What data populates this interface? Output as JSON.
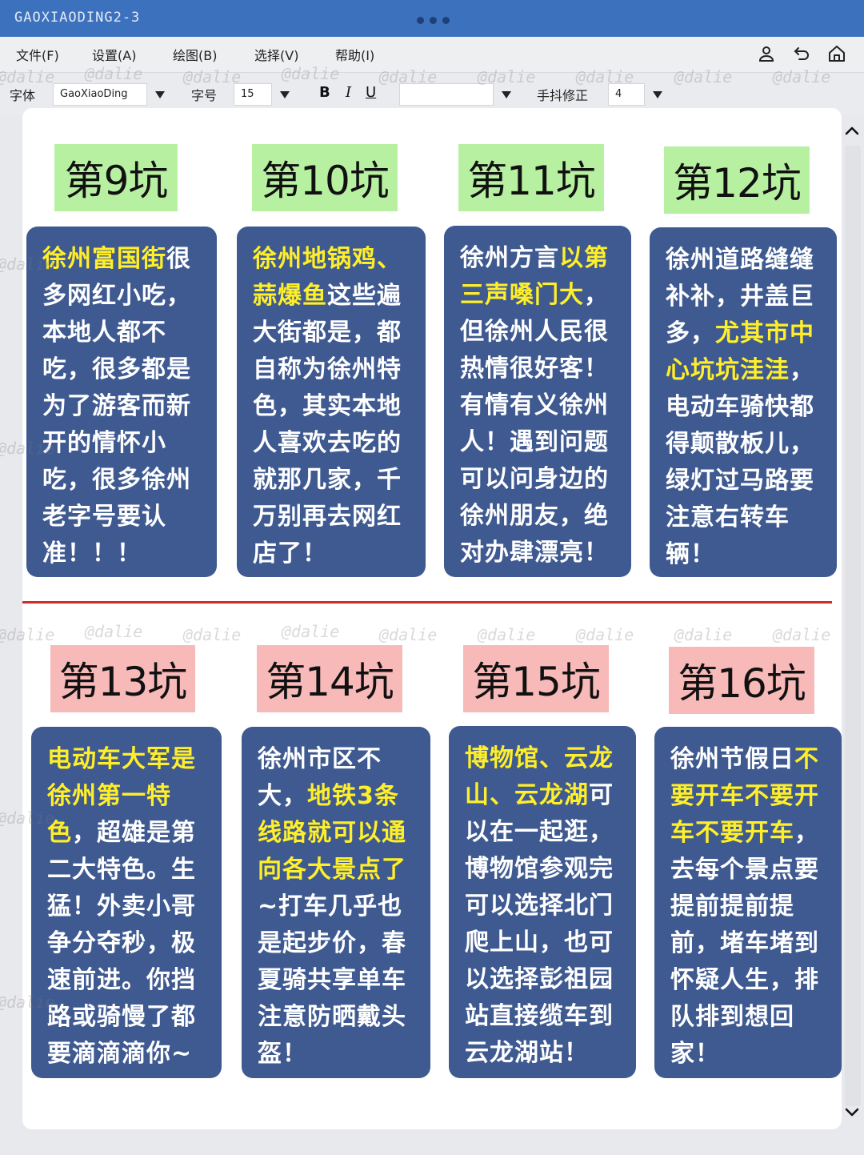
{
  "window": {
    "title": "GAOXIAODING2-3"
  },
  "menu": {
    "items": [
      "文件(F)",
      "设置(A)",
      "绘图(B)",
      "选择(V)",
      "帮助(I)"
    ],
    "icons": [
      "user-icon",
      "undo-icon",
      "home-icon"
    ]
  },
  "toolbar": {
    "font_label": "字体",
    "font_value": "GaoXiaoDing",
    "size_label": "字号",
    "size_value": "15",
    "bold": "B",
    "italic": "I",
    "underline": "U",
    "color_value": "",
    "shake_label": "手抖修正",
    "shake_value": "4"
  },
  "watermark": "@dalie",
  "colors": {
    "titlebar": "#3c71be",
    "card": "#3f5a91",
    "highlight": "#ffef2a",
    "title_green": "#b7f0a0",
    "title_pink": "#f8b9b9",
    "divider": "#d12b2b"
  },
  "pits": [
    {
      "title": "第9坑",
      "segments": [
        {
          "t": "徐州富国街",
          "h": true
        },
        {
          "t": "很多网红小吃，本地人都不吃，很多都是为了游客而新开的情怀小吃，很多徐州老字号要认准！！！",
          "h": false
        }
      ]
    },
    {
      "title": "第10坑",
      "segments": [
        {
          "t": "徐州地锅鸡、蒜爆鱼",
          "h": true
        },
        {
          "t": "这些遍大街都是，都自称为徐州特色，其实本地人喜欢去吃的就那几家，千万别再去网红店了！",
          "h": false
        }
      ]
    },
    {
      "title": "第11坑",
      "segments": [
        {
          "t": "徐州方言",
          "h": false
        },
        {
          "t": "以第三声嗓门大",
          "h": true
        },
        {
          "t": "，但徐州人民很热情很好客！有情有义徐州人！遇到问题可以问身边的徐州朋友，绝对办肆漂亮！",
          "h": false
        }
      ]
    },
    {
      "title": "第12坑",
      "segments": [
        {
          "t": "徐州道路缝缝补补，井盖巨多，",
          "h": false
        },
        {
          "t": "尤其市中心坑坑洼洼",
          "h": true
        },
        {
          "t": "，电动车骑快都得颠散板儿，绿灯过马路要注意右转车辆！",
          "h": false
        }
      ]
    },
    {
      "title": "第13坑",
      "segments": [
        {
          "t": "电动车大军是徐州第一特色",
          "h": true
        },
        {
          "t": "，超雄是第二大特色。生猛！外卖小哥争分夺秒，极速前进。你挡路或骑慢了都要滴滴滴你~",
          "h": false
        }
      ]
    },
    {
      "title": "第14坑",
      "segments": [
        {
          "t": "徐州市区不大，",
          "h": false
        },
        {
          "t": "地铁3条线路就可以通向各大景点了",
          "h": true
        },
        {
          "t": "~打车几乎也是起步价，春夏骑共享单车注意防晒戴头盔！",
          "h": false
        }
      ]
    },
    {
      "title": "第15坑",
      "segments": [
        {
          "t": "博物馆、云龙山、云龙湖",
          "h": true
        },
        {
          "t": "可以在一起逛，博物馆参观完可以选择北门爬上山，也可以选择彭祖园站直接缆车到云龙湖站！",
          "h": false
        }
      ]
    },
    {
      "title": "第16坑",
      "segments": [
        {
          "t": "徐州节假日",
          "h": false
        },
        {
          "t": "不要开车不要开车不要开车",
          "h": true
        },
        {
          "t": "，去每个景点要提前提前提前，堵车堵到怀疑人生，排队排到想回家！",
          "h": false
        }
      ]
    }
  ]
}
